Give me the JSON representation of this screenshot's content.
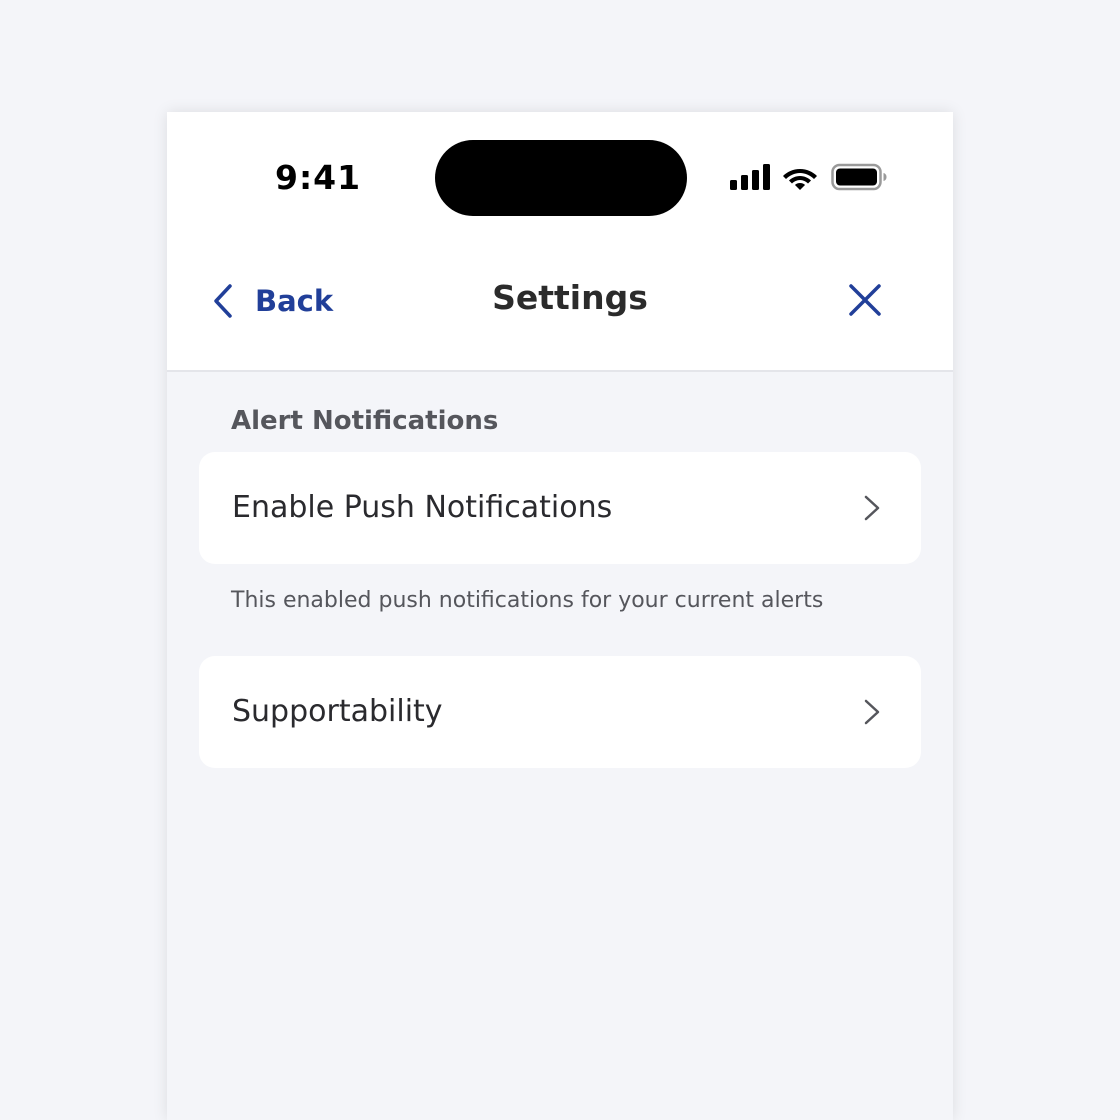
{
  "status_bar": {
    "time": "9:41",
    "icons": [
      "signal-icon",
      "wifi-icon",
      "battery-icon"
    ]
  },
  "nav": {
    "back_label": "Back",
    "title": "Settings",
    "back_icon": "chevron-left-icon",
    "close_icon": "close-icon"
  },
  "sections": [
    {
      "header": "Alert Notifications",
      "items": [
        {
          "label": "Enable Push Notifications",
          "helper": "This enabled push notifications for your current alerts"
        }
      ]
    },
    {
      "items": [
        {
          "label": "Supportability"
        }
      ]
    }
  ],
  "colors": {
    "accent": "#213f99",
    "background": "#f4f5f9",
    "card": "#ffffff",
    "title_text": "#2b2b2b",
    "secondary_text": "#55565c"
  }
}
